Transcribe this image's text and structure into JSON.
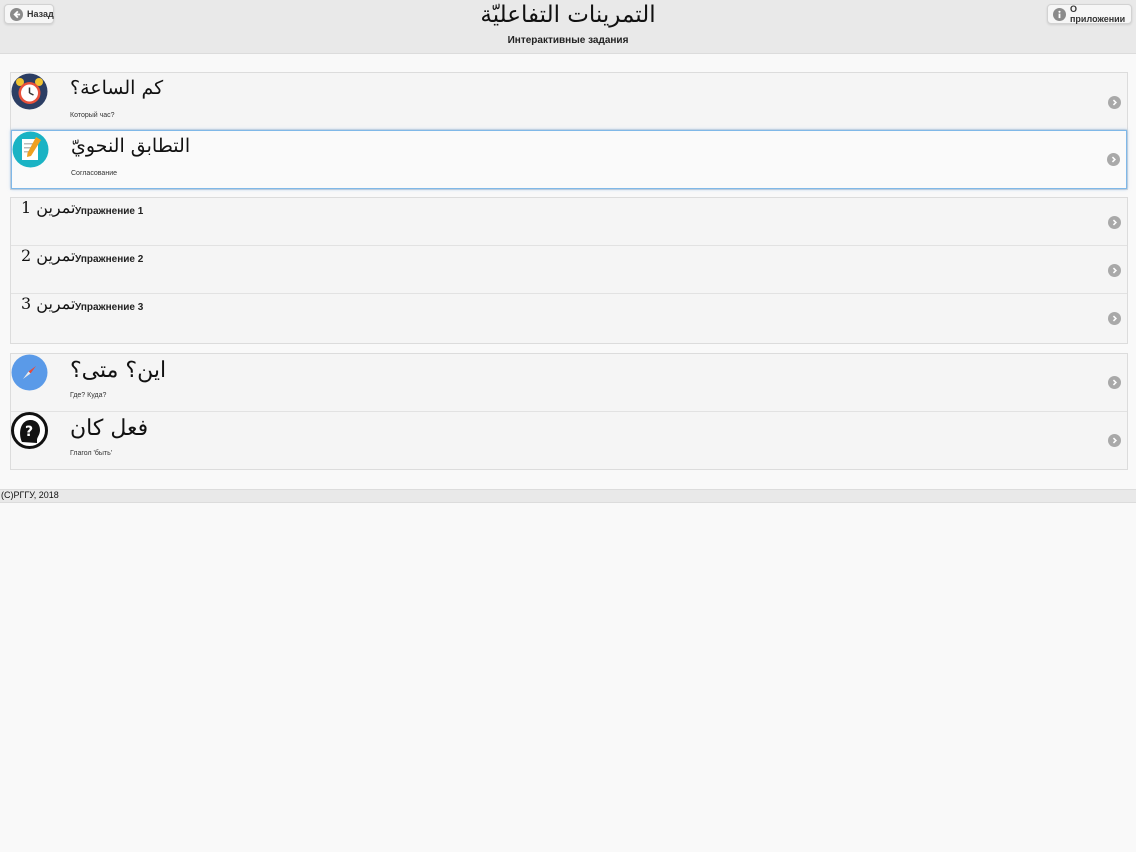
{
  "header": {
    "back_label": "Назад",
    "title": "التمرينات التفاعليّة",
    "subtitle": "Интерактивные задания",
    "about_label": "О приложении"
  },
  "items": [
    {
      "title": "كم الساعة؟",
      "subtitle": "Который час?",
      "icon": "alarm-clock-icon"
    },
    {
      "title": "التطابق النحويّ",
      "subtitle": "Согласование",
      "icon": "notepad-pencil-icon"
    }
  ],
  "exercises": [
    {
      "ar": "تمرين 1",
      "ru": "Упражнение 1"
    },
    {
      "ar": "تمرين 2",
      "ru": "Упражнение 2"
    },
    {
      "ar": "تمرين 3",
      "ru": "Упражнение 3"
    }
  ],
  "items2": [
    {
      "title": "اين؟ متى؟",
      "subtitle": "Где? Куда?",
      "icon": "compass-icon"
    },
    {
      "title": "فعل كان",
      "subtitle": "Глагол 'быть'",
      "icon": "question-head-icon"
    }
  ],
  "footer": {
    "text": "(C)РГГУ, 2018"
  },
  "colors": {
    "header_bg": "#e9e9e9",
    "selected_border": "#7fb8e8",
    "chevron": "#a9a9a9"
  }
}
